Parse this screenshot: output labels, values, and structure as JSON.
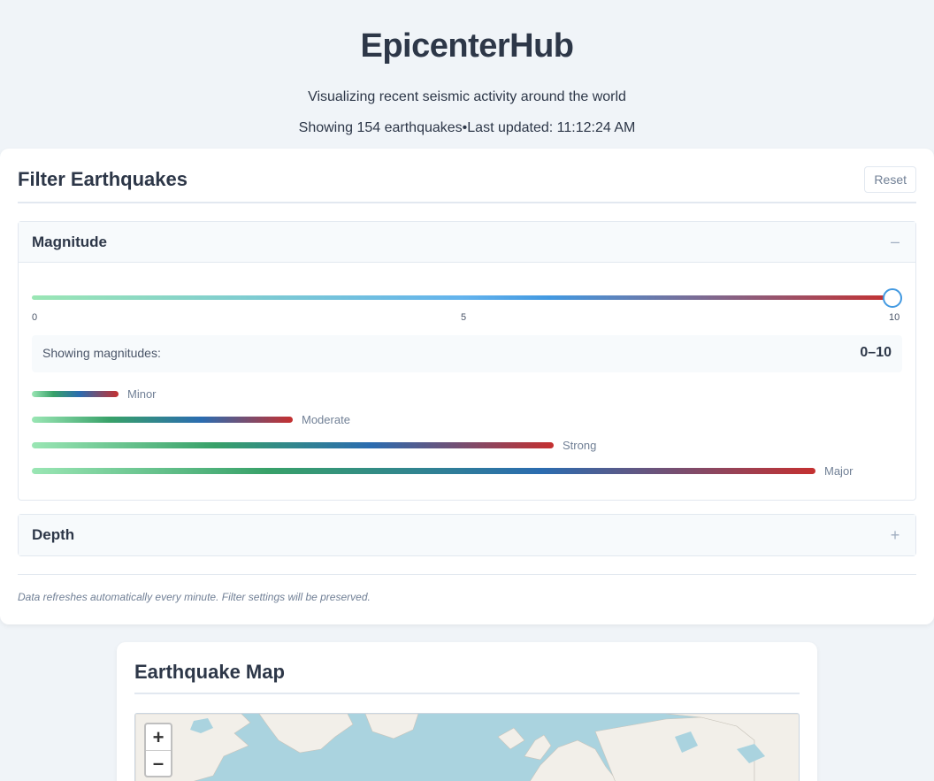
{
  "header": {
    "title": "EpicenterHub",
    "subtitle": "Visualizing recent seismic activity around the world",
    "status": "Showing 154 earthquakes•Last updated: 11:12:24 AM"
  },
  "filters": {
    "title": "Filter Earthquakes",
    "reset_label": "Reset",
    "magnitude": {
      "title": "Magnitude",
      "toggle": "–",
      "expanded": true,
      "slider_min": 0,
      "slider_max": 10,
      "slider_value": 10,
      "tick_labels": [
        "0",
        "5",
        "10"
      ],
      "summary_label": "Showing magnitudes:",
      "summary_value": "0–10",
      "scale_labels": [
        "Minor",
        "Moderate",
        "Strong",
        "Major"
      ]
    },
    "depth": {
      "title": "Depth",
      "toggle": "+",
      "expanded": false
    },
    "footnote": "Data refreshes automatically every minute. Filter settings will be preserved."
  },
  "map": {
    "title": "Earthquake Map",
    "zoom_in": "+",
    "zoom_out": "–"
  },
  "colors": {
    "background": "#f0f4f8",
    "card": "#ffffff",
    "text": "#2d3748",
    "accent": "#4299e1",
    "scale_start": "#9ae6b4",
    "scale_end": "#c53030",
    "water": "#aad3df",
    "land": "#f2efe9"
  }
}
